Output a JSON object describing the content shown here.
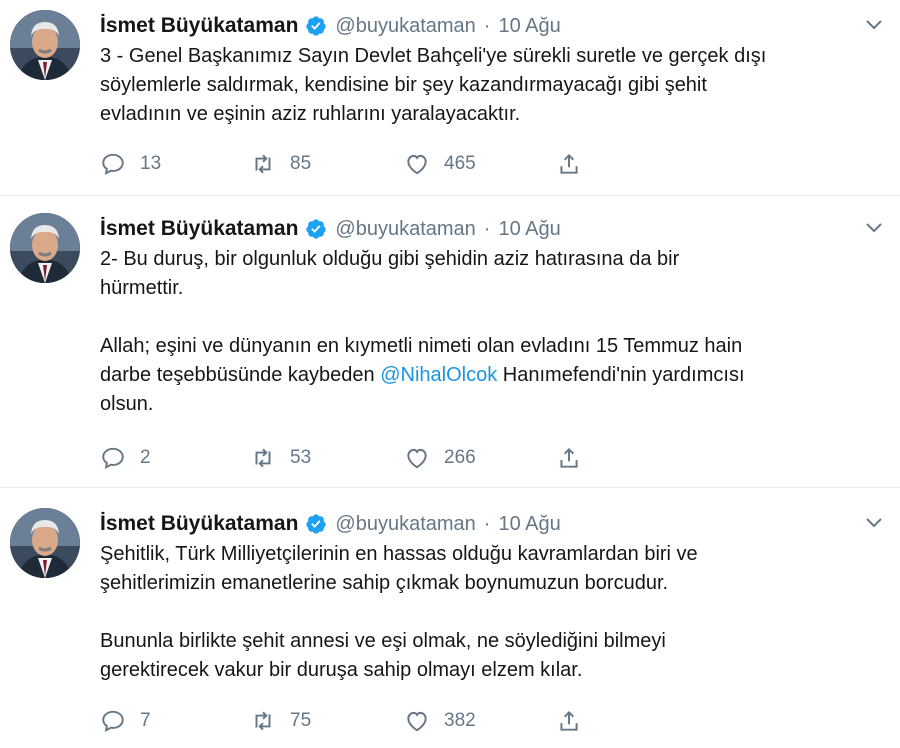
{
  "tweets": [
    {
      "name": "İsmet Büyükataman",
      "handle": "@buyukataman",
      "separator": "·",
      "date": "10 Ağu",
      "text": "3 - Genel Başkanımız Sayın Devlet Bahçeli'ye sürekli suretle ve gerçek dışı\nsöylemlerle saldırmak, kendisine bir şey kazandırmayacağı gibi şehit\nevladının ve eşinin aziz ruhlarını yaralayacaktır.",
      "replies": "13",
      "retweets": "85",
      "likes": "465"
    },
    {
      "name": "İsmet Büyükataman",
      "handle": "@buyukataman",
      "separator": "·",
      "date": "10 Ağu",
      "text_before": "2- Bu duruş, bir olgunluk olduğu gibi şehidin aziz hatırasına da bir\nhürmettir.\n\nAllah; eşini ve dünyanın en kıymetli nimeti olan evladını 15 Temmuz hain\ndarbe teşebbüsünde kaybeden ",
      "mention": "@NihalOlcok",
      "text_after": " Hanımefendi'nin yardımcısı\nolsun.",
      "replies": "2",
      "retweets": "53",
      "likes": "266"
    },
    {
      "name": "İsmet Büyükataman",
      "handle": "@buyukataman",
      "separator": "·",
      "date": "10 Ağu",
      "text": "Şehitlik, Türk Milliyetçilerinin en hassas olduğu kavramlardan biri ve\nşehitlerimizin emanetlerine sahip çıkmak boynumuzun borcudur.\n\nBununla birlikte şehit annesi ve eşi olmak, ne söylediğini bilmeyi\ngerektirecek vakur bir duruşa sahip olmayı elzem kılar.",
      "replies": "7",
      "retweets": "75",
      "likes": "382"
    }
  ],
  "icons": {
    "verified": "verified-badge-icon",
    "caret": "chevron-down-icon",
    "reply": "reply-icon",
    "retweet": "retweet-icon",
    "like": "heart-icon",
    "share": "share-icon"
  },
  "colors": {
    "verified": "#1da1f2",
    "mention": "#1b95e0",
    "muted": "#657786",
    "separator": "#e6ecf0"
  }
}
